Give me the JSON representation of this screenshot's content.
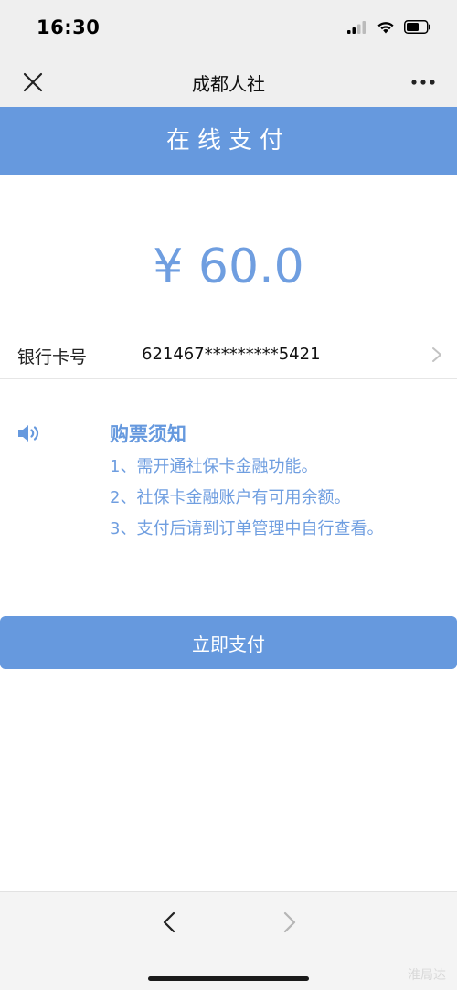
{
  "status_bar": {
    "time": "16:30"
  },
  "nav": {
    "title": "成都人社"
  },
  "banner": {
    "title": "在线支付"
  },
  "payment": {
    "amount": "¥ 60.0"
  },
  "card": {
    "label": "银行卡号",
    "number": "621467*********5421"
  },
  "notice": {
    "title": "购票须知",
    "lines": [
      "1、需开通社保卡金融功能。",
      "2、社保卡金融账户有可用余额。",
      "3、支付后请到订单管理中自行查看。"
    ]
  },
  "actions": {
    "pay_label": "立即支付"
  },
  "watermark": "淮局达",
  "colors": {
    "accent": "#6699de",
    "amount_text": "#6f9ee0"
  },
  "icons": [
    "signal-icon",
    "wifi-icon",
    "battery-icon",
    "close-icon",
    "more-icon",
    "chevron-right-icon",
    "speaker-icon",
    "back-arrow-icon",
    "forward-arrow-icon"
  ]
}
